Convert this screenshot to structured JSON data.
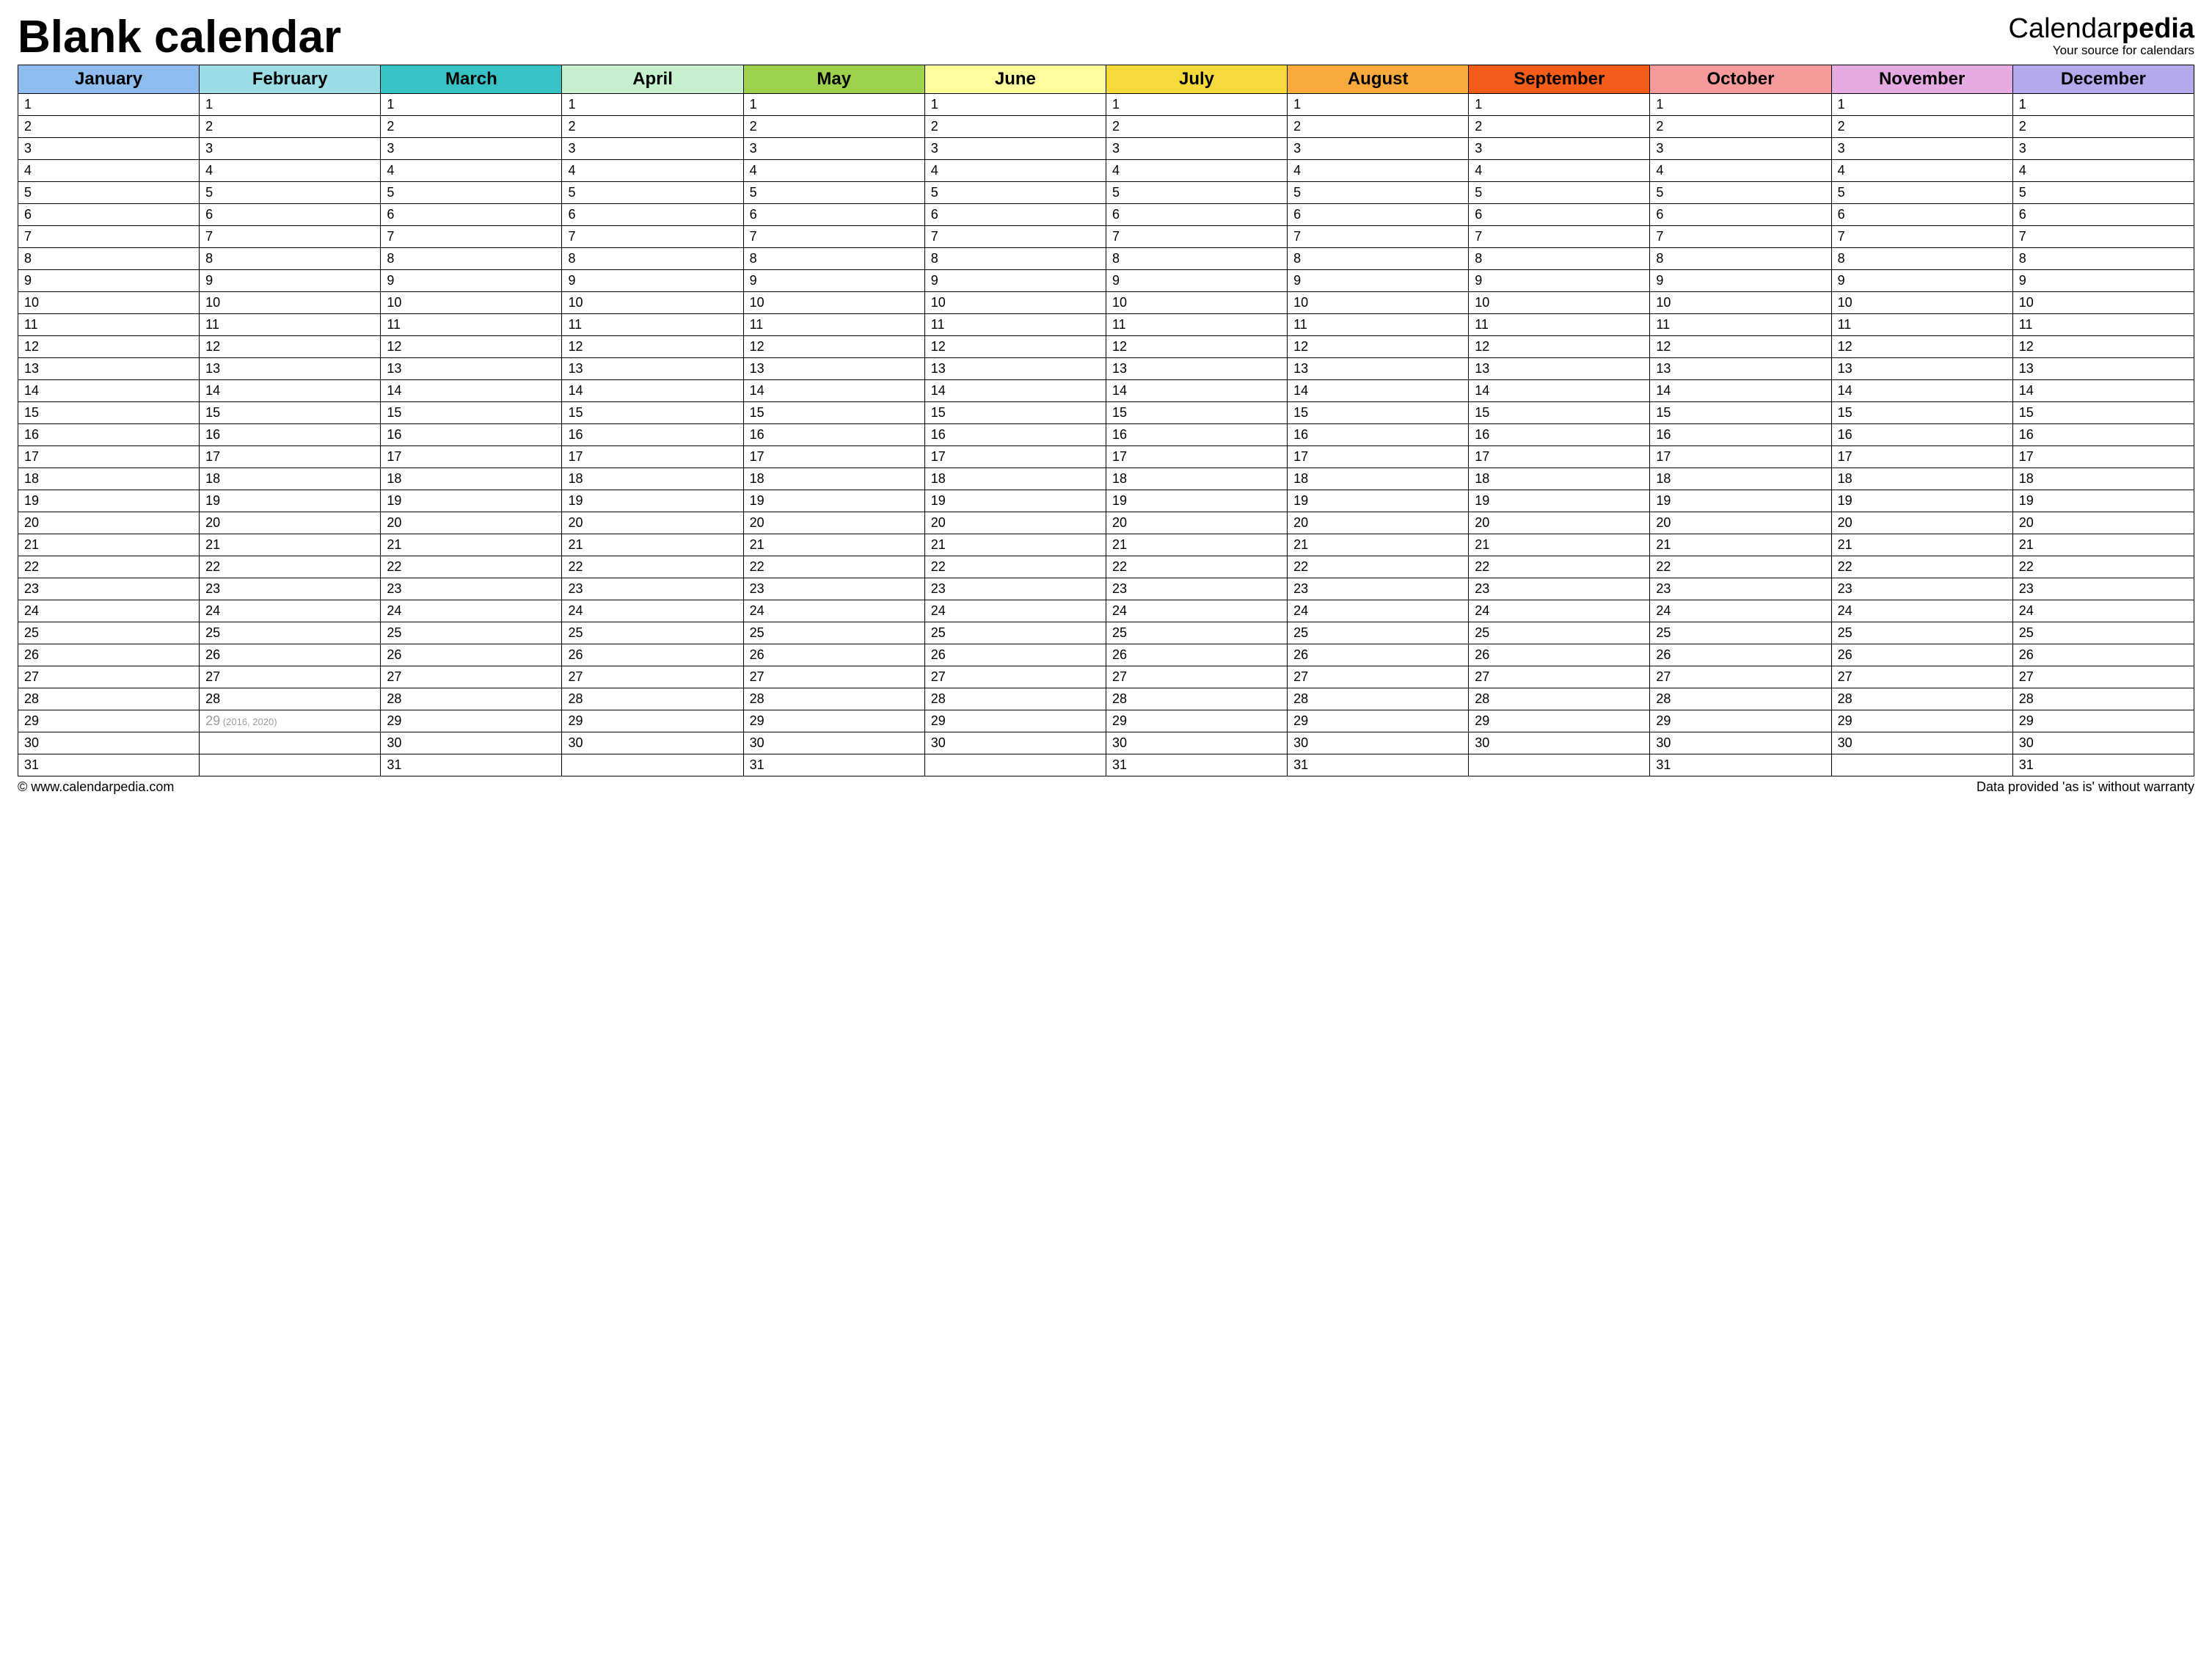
{
  "title": "Blank calendar",
  "brand": {
    "prefix": "Calendar",
    "bold": "pedia",
    "tagline": "Your source for calendars"
  },
  "months": [
    {
      "name": "January",
      "maxDays": 31
    },
    {
      "name": "February",
      "maxDays": 29
    },
    {
      "name": "March",
      "maxDays": 31
    },
    {
      "name": "April",
      "maxDays": 30
    },
    {
      "name": "May",
      "maxDays": 31
    },
    {
      "name": "June",
      "maxDays": 30
    },
    {
      "name": "July",
      "maxDays": 31
    },
    {
      "name": "August",
      "maxDays": 31
    },
    {
      "name": "September",
      "maxDays": 30
    },
    {
      "name": "October",
      "maxDays": 31
    },
    {
      "name": "November",
      "maxDays": 30
    },
    {
      "name": "December",
      "maxDays": 31
    }
  ],
  "leapNote": "(2016, 2020)",
  "footer": {
    "left": "© www.calendarpedia.com",
    "right": "Data provided 'as is' without warranty"
  }
}
